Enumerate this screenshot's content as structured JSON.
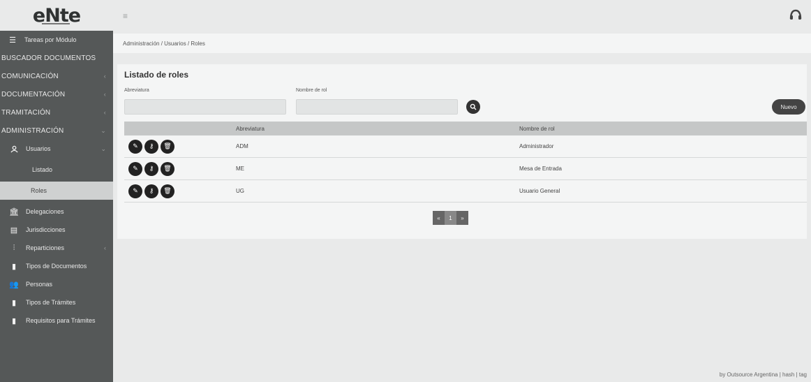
{
  "app": {
    "logo": "eNte"
  },
  "sidebar": {
    "top": {
      "label": "Tareas por Módulo",
      "icon": "list-icon"
    },
    "sections": [
      {
        "label": "BUSCADOR DOCUMENTOS",
        "chevron": false
      },
      {
        "label": "COMUNICACIÓN",
        "chevron": true
      },
      {
        "label": "DOCUMENTACIÓN",
        "chevron": true
      },
      {
        "label": "TRAMITACIÓN",
        "chevron": true
      },
      {
        "label": "ADMINISTRACIÓN",
        "chevron": true
      }
    ],
    "usuarios": {
      "label": "Usuarios"
    },
    "listado": {
      "label": "Listado"
    },
    "roles": {
      "label": "Roles"
    },
    "items": [
      {
        "label": "Delegaciones",
        "icon": "bank-icon"
      },
      {
        "label": "Jurisdicciones",
        "icon": "building-icon"
      },
      {
        "label": "Reparticiones",
        "icon": "sitemap-icon"
      },
      {
        "label": "Tipos de Documentos",
        "icon": "file-icon"
      },
      {
        "label": "Personas",
        "icon": "users-icon"
      },
      {
        "label": "Tipos de Trámites",
        "icon": "files-icon"
      },
      {
        "label": "Requisitos para Trámites",
        "icon": "clipboard-icon"
      }
    ]
  },
  "breadcrumb": "Administración / Usuarios / Roles",
  "main": {
    "title": "Listado de roles",
    "abreviatura_label": "Abreviatura",
    "nombre_label": "Nombre de rol",
    "abreviatura_value": "",
    "nombre_value": "",
    "nuevo_label": "Nuevo"
  },
  "table": {
    "headers": [
      "",
      "Abreviatura",
      "Nombre de rol"
    ],
    "rows": [
      {
        "abv": "ADM",
        "nombre": "Administrador"
      },
      {
        "abv": "ME",
        "nombre": "Mesa de Entrada"
      },
      {
        "abv": "UG",
        "nombre": "Usuario General"
      }
    ]
  },
  "pager": {
    "prev": "«",
    "current": "1",
    "next": "»"
  },
  "footer": "by Outsource Argentina | hash | tag",
  "colors": {
    "sidebar": "#555858",
    "active": "#cfd1d1",
    "buttons": "#222222"
  }
}
